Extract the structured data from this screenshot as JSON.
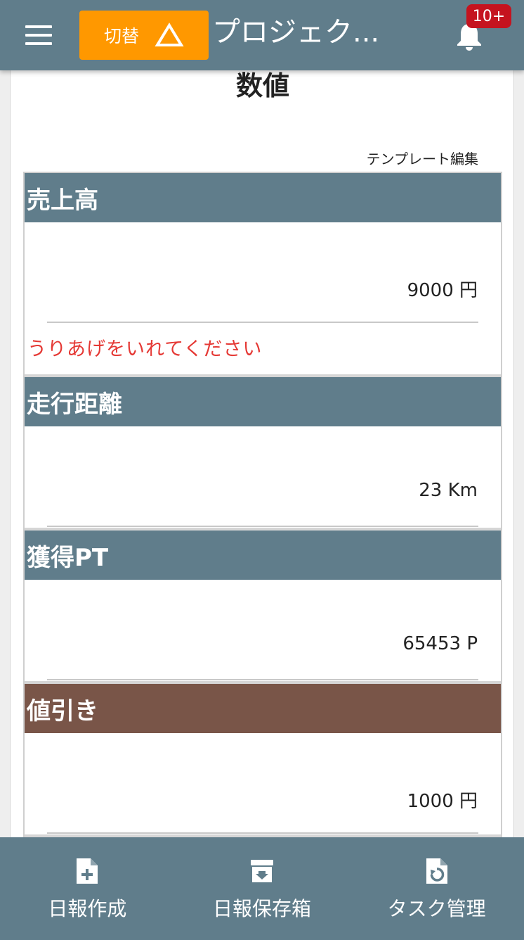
{
  "appbar": {
    "menu_icon": "hamburger-menu-icon",
    "switch_label": "切替",
    "switch_icon": "triangle-warning-icon",
    "title": "プロジェク...",
    "bell_icon": "bell-icon",
    "badge": "10+"
  },
  "page": {
    "title": "数値",
    "template_edit": "テンプレート編集"
  },
  "fields": [
    {
      "label": "売上高",
      "value": "9000 円",
      "error": "うりあげをいれてください",
      "header_color": "#607d8b"
    },
    {
      "label": "走行距離",
      "value": "23 Km",
      "header_color": "#607d8b"
    },
    {
      "label": "獲得PT",
      "value": "65453 P",
      "header_color": "#607d8b"
    },
    {
      "label": "値引き",
      "value": "1000 円",
      "header_color": "#795548"
    }
  ],
  "bottom_nav": [
    {
      "label": "日報作成",
      "icon": "file-add-icon"
    },
    {
      "label": "日報保存箱",
      "icon": "archive-box-icon"
    },
    {
      "label": "タスク管理",
      "icon": "file-refresh-icon"
    }
  ],
  "colors": {
    "primary": "#607d8b",
    "accent": "#ff9800",
    "brown": "#795548",
    "badge": "#c5131f",
    "error": "#e53935"
  }
}
